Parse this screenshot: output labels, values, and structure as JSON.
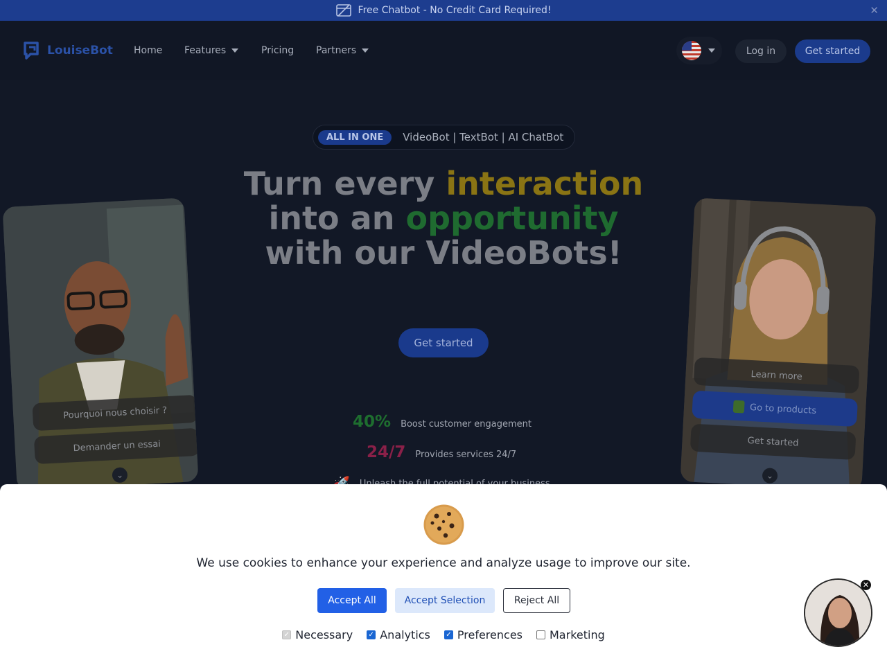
{
  "banner": {
    "text": "Free Chatbot - No Credit Card Required!",
    "close": "✕"
  },
  "nav": {
    "brand": "LouiseBot",
    "links": [
      {
        "label": "Home"
      },
      {
        "label": "Features"
      },
      {
        "label": "Pricing"
      },
      {
        "label": "Partners"
      }
    ],
    "login": "Log in",
    "get_started": "Get started"
  },
  "hero": {
    "tag": "ALL IN ONE",
    "tagline": "VideoBot | TextBot | AI ChatBot",
    "title_a": "Turn every ",
    "title_gold": "interaction",
    "title_b": "into an ",
    "title_green": "opportunity",
    "title_c": "with our VideoBots!",
    "cta": "Get started"
  },
  "stats": [
    {
      "num": "40%",
      "label": "Boost customer engagement",
      "color": "#1e6e2f"
    },
    {
      "num": "24/7",
      "label": "Provides services 24/7",
      "color": "#8a2048"
    },
    {
      "label": "Unleash the full potential of your business"
    }
  ],
  "card_left": {
    "btn1": "Pourquoi nous choisir ?",
    "btn2": "Demander un essai"
  },
  "card_right": {
    "btn1": "Learn more",
    "btn2": "Go to products",
    "btn3": "Get started"
  },
  "cookie": {
    "message": "We use cookies to enhance your experience and analyze usage to improve our site.",
    "accept_all": "Accept All",
    "accept_selection": "Accept Selection",
    "reject_all": "Reject All",
    "options": [
      {
        "label": "Necessary",
        "checked": true,
        "disabled": true
      },
      {
        "label": "Analytics",
        "checked": true
      },
      {
        "label": "Preferences",
        "checked": true
      },
      {
        "label": "Marketing",
        "checked": false
      }
    ]
  },
  "colors": {
    "brand_blue": "#2260e6",
    "nav_bg": "#111725",
    "banner_bg": "#1d3d8f"
  }
}
